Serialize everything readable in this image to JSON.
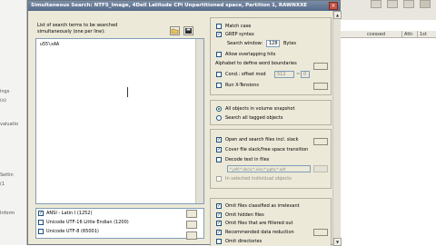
{
  "dialog": {
    "title": "Simultaneous Search: NTFS_Image, 4Dell Latitude CPi Unpartitioned space, Partition 1, RAWNXXE",
    "instruction_line1": "List of search terms to be searched",
    "instruction_line2": "simultaneously (one per line):",
    "search_terms_value": "u55\\xAA"
  },
  "code_pages": [
    {
      "label": "ANSI - Latin I (1252)",
      "checked": true
    },
    {
      "label": "Unicode UTF-16 Little Endian (1200)",
      "checked": false
    },
    {
      "label": "Unicode UTF-8 (65001)",
      "checked": false
    }
  ],
  "options": {
    "match_case": "Match case",
    "grep_syntax": "GREP syntax",
    "search_window_label": "Search window:",
    "search_window_value": "128",
    "search_window_unit": "Bytes",
    "allow_overlapping": "Allow overlapping hits",
    "alphabet_label": "Alphabet to define word boundaries",
    "cond_offset_label": "Cond.: offset mod",
    "cond_offset_value1": "512",
    "cond_offset_value2": "0",
    "run_xtensions": "Run X-Tensions"
  },
  "scope": {
    "all_objects": "All objects in volume snapshot",
    "search_tagged": "Search all tagged objects"
  },
  "open_search": {
    "open_and_search": "Open and search files incl. slack",
    "cover_transition": "Cover file slack/free space transition",
    "decode_text": "Decode text in files",
    "decode_field": "*.pdf;*.docx;*.xlsx;*.pptx;*.odt",
    "in_selected_items": "In selected individual objects"
  },
  "omit": {
    "omit_irrelevant": "Omit files classified as irrelevant",
    "omit_hidden": "Omit hidden files",
    "omit_filtered": "Omit files that are filtered out",
    "recommended": "Recommended data reduction",
    "omit_directories": "Omit directories"
  },
  "background": {
    "col_accessed": "ccessed",
    "col_attr": "Attr.",
    "col_1st": "1st",
    "side_items": [
      "ings",
      "(o)",
      "valuatio",
      "Settin",
      "(1",
      "Inform"
    ]
  }
}
